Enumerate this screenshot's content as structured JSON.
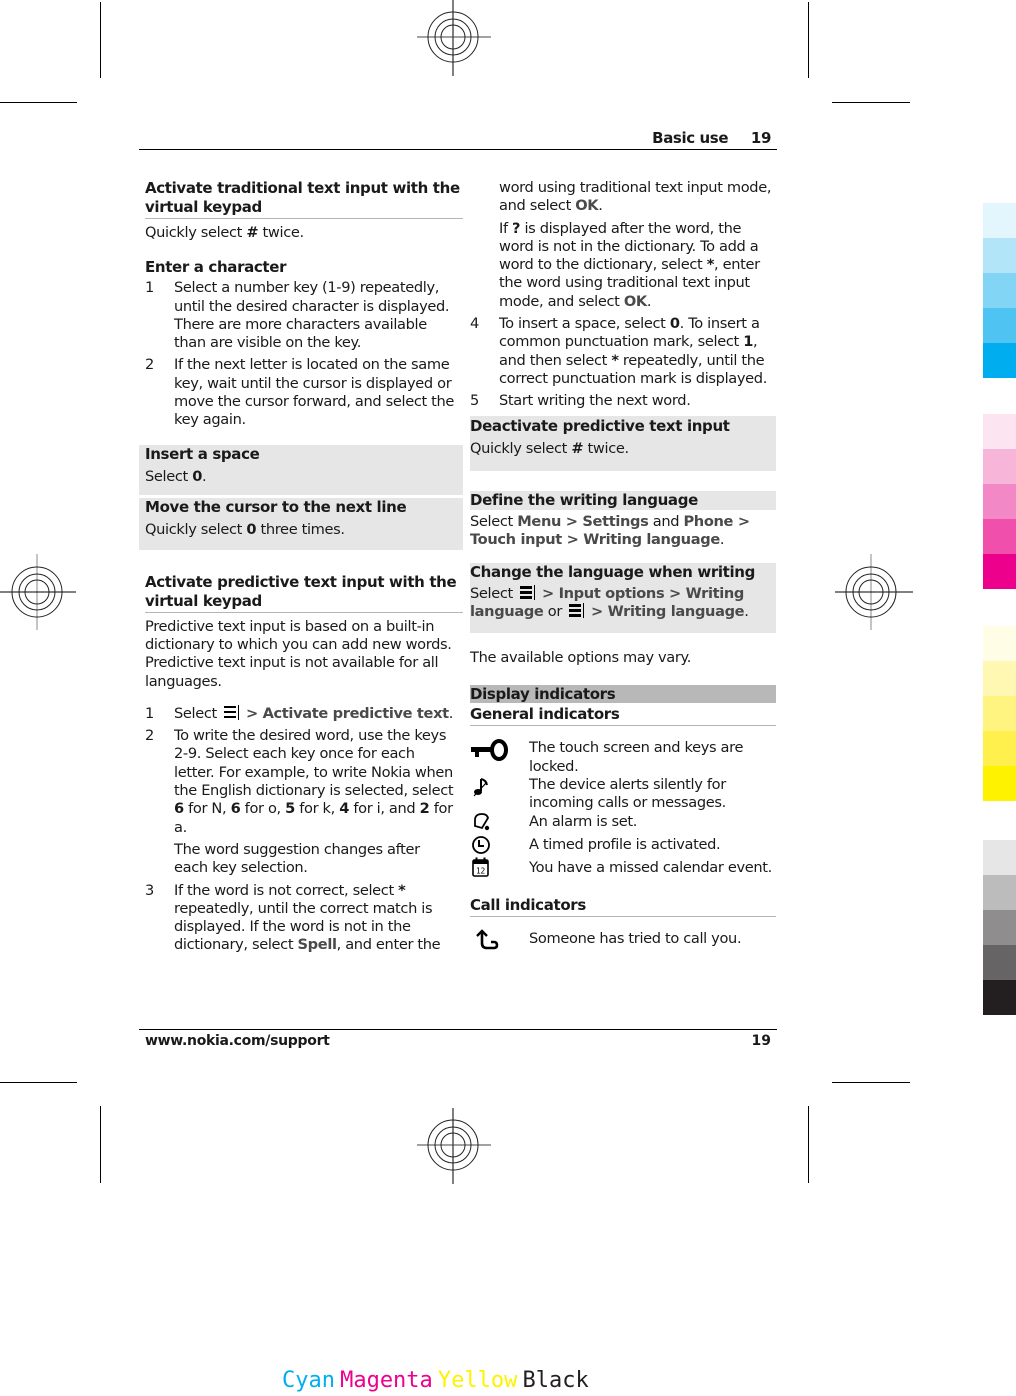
{
  "header": {
    "section": "Basic use",
    "page_number": "19"
  },
  "footer": {
    "url": "www.nokia.com/support",
    "page_number": "19"
  },
  "left_column": {
    "traditional": {
      "title": "Activate traditional text input with the virtual keypad",
      "body_pre": "Quickly select ",
      "body_key": "#",
      "body_post": " twice."
    },
    "enter_character": {
      "title": "Enter a character",
      "steps": [
        {
          "num": "1",
          "text": "Select a number key (1-9) repeatedly, until the desired character is displayed. There are more characters available than are visible on the key."
        },
        {
          "num": "2",
          "text": "If the next letter is located on the same key, wait until the cursor is displayed or move the cursor forward, and select the key again."
        }
      ]
    },
    "insert_space": {
      "title": "Insert a space",
      "pre": "Select ",
      "key": "0",
      "post": "."
    },
    "next_line": {
      "title": "Move the cursor to the next line",
      "pre": "Quickly select ",
      "key": "0",
      "post": " three times."
    },
    "predictive": {
      "title": "Activate predictive text input with the virtual keypad",
      "intro": "Predictive text input is based on a built-in dictionary to which you can add new words. Predictive text input is not available for all languages.",
      "step1": {
        "num": "1",
        "pre": "Select",
        "sep": " > ",
        "option": "Activate predictive text",
        "post": "."
      },
      "step2": {
        "num": "2",
        "a": "To write the desired word, use the keys 2-9. Select each key once for each letter. For example, to write Nokia when the English dictionary is selected, select ",
        "k1": "6",
        "b": " for N, ",
        "k2": "6",
        "c": " for o, ",
        "k3": "5",
        "d": " for k, ",
        "k4": "4",
        "e": " for i, and ",
        "k5": "2",
        "f": " for a.",
        "note": "The word suggestion changes after each key selection."
      },
      "step3": {
        "num": "3",
        "a": "If the word is not correct, select ",
        "k1": "*",
        "b": " repeatedly, until the correct match is displayed. If the word is not in the dictionary, select ",
        "spell": "Spell",
        "c": ", and enter the"
      }
    }
  },
  "right_column": {
    "step3_cont": {
      "a": "word using traditional text input mode, and select ",
      "ok": "OK",
      "b": "."
    },
    "step3_note": {
      "a": "If ",
      "q": "?",
      "b": " is displayed after the word, the word is not in the dictionary. To add a word to the dictionary, select ",
      "star": "*",
      "c": ", enter the word using traditional text input mode, and select ",
      "ok": "OK",
      "d": "."
    },
    "step4": {
      "num": "4",
      "a": "To insert a space, select ",
      "k1": "0",
      "b": ". To insert a common punctuation mark, select ",
      "k2": "1",
      "c": ", and then select ",
      "k3": "*",
      "d": " repeatedly, until the correct punctuation mark is displayed."
    },
    "step5": {
      "num": "5",
      "text": "Start writing the next word."
    },
    "deactivate": {
      "title": "Deactivate predictive text input",
      "pre": "Quickly select ",
      "key": "#",
      "post": " twice."
    },
    "define_language": {
      "title": "Define the writing language",
      "pre": "Select ",
      "menu": "Menu",
      "sep1": "  > ",
      "settings": "Settings",
      "and": " and ",
      "phone": "Phone",
      "sep2": "  > ",
      "touch_input": "Touch input",
      "sep3": "  > ",
      "writing_language": "Writing language",
      "post": "."
    },
    "change_language": {
      "title": "Change the language when writing",
      "pre": "Select ",
      "sep1": "  > ",
      "input_options": "Input options",
      "sep2": "  > ",
      "writing_language_a": "Writing language",
      "or": " or ",
      "sep3": "  > ",
      "writing_language_b": "Writing language",
      "post": "."
    },
    "options_note": "The available options may vary.",
    "display_indicators": {
      "title": "Display indicators",
      "general_title": "General indicators",
      "general": [
        {
          "icon": "key-lock-icon",
          "text": "The touch screen and keys are locked."
        },
        {
          "icon": "silent-alert-icon",
          "text": "The device alerts silently for incoming calls or messages."
        },
        {
          "icon": "alarm-bell-icon",
          "text": "An alarm is set."
        },
        {
          "icon": "clock-icon",
          "text": "A timed profile is activated."
        },
        {
          "icon": "calendar-icon",
          "text": "You have a missed calendar event.",
          "icon_label": "12"
        }
      ],
      "call_title": "Call indicators",
      "call": [
        {
          "icon": "missed-call-icon",
          "text": "Someone has tried to call you."
        }
      ]
    }
  },
  "print_marks": {
    "color_bar_label": {
      "cyan": "Cyan",
      "magenta": "Magenta",
      "yellow": "Yellow",
      "black": "Black"
    },
    "label_colors": {
      "cyan": "#00aeef",
      "magenta": "#ec008c",
      "yellow": "#fff200",
      "black": "#231f20"
    },
    "swatches": {
      "cyan": [
        "#e3f5fd",
        "#b3e5f8",
        "#83d5f6",
        "#4fc3f1",
        "#00aeef"
      ],
      "magenta": [
        "#fce4f0",
        "#f8b5da",
        "#f388c6",
        "#f04fab",
        "#ec008c"
      ],
      "yellow": [
        "#fffde6",
        "#fff8b3",
        "#fff480",
        "#fff04d",
        "#fff200"
      ],
      "black": [
        "#e6e6e6",
        "#bcbcbc",
        "#8f8d8d",
        "#666464",
        "#231f20"
      ]
    }
  }
}
